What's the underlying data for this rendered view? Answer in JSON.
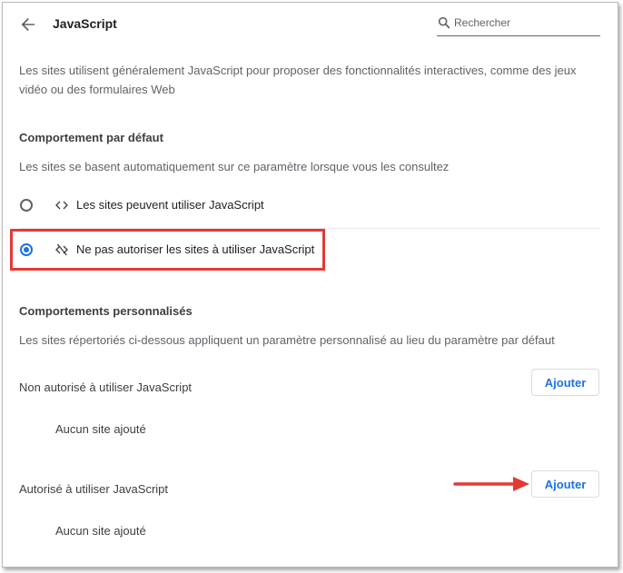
{
  "header": {
    "title": "JavaScript",
    "search_placeholder": "Rechercher"
  },
  "description": "Les sites utilisent généralement JavaScript pour proposer des fonctionnalités interactives, comme des jeux vidéo ou des formulaires Web",
  "default_behavior": {
    "heading": "Comportement par défaut",
    "subtitle": "Les sites se basent automatiquement sur ce paramètre lorsque vous les consultez",
    "options": [
      {
        "label": "Les sites peuvent utiliser JavaScript",
        "selected": false,
        "icon": "code-icon"
      },
      {
        "label": "Ne pas autoriser les sites à utiliser JavaScript",
        "selected": true,
        "icon": "code-off-icon"
      }
    ]
  },
  "custom_behaviors": {
    "heading": "Comportements personnalisés",
    "subtitle": "Les sites répertoriés ci-dessous appliquent un paramètre personnalisé au lieu du paramètre par défaut",
    "blocked": {
      "label": "Non autorisé à utiliser JavaScript",
      "button": "Ajouter",
      "empty": "Aucun site ajouté"
    },
    "allowed": {
      "label": "Autorisé à utiliser JavaScript",
      "button": "Ajouter",
      "empty": "Aucun site ajouté"
    }
  },
  "colors": {
    "accent": "#1a73e8",
    "annotation": "#e53935"
  }
}
